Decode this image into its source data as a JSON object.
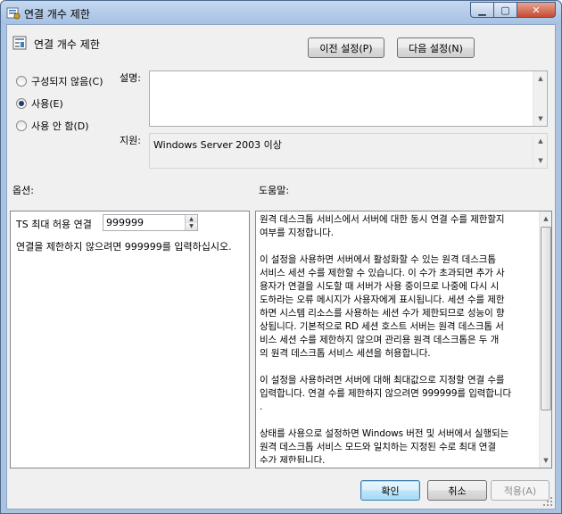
{
  "window": {
    "title": "연결 개수 제한"
  },
  "header": {
    "title": "연결 개수 제한",
    "prev_button": "이전 설정(P)",
    "next_button": "다음 설정(N)"
  },
  "state": {
    "options": [
      {
        "label": "구성되지 않음(C)",
        "checked": false
      },
      {
        "label": "사용(E)",
        "checked": true
      },
      {
        "label": "사용 안 함(D)",
        "checked": false
      }
    ]
  },
  "comment": {
    "label": "설명:",
    "value": ""
  },
  "supported": {
    "label": "지원:",
    "value": "Windows Server 2003 이상"
  },
  "options_section": {
    "label": "옵션:",
    "field_label": "TS 최대 허용 연결",
    "field_value": "999999",
    "note": "연결을 제한하지 않으려면 999999를 입력하십시오."
  },
  "help_section": {
    "label": "도움말:",
    "text": "원격 데스크톱 서비스에서 서버에 대한 동시 연결 수를 제한할지\n여부를 지정합니다.\n\n이 설정을 사용하면 서버에서 활성화할 수 있는 원격 데스크톱\n서비스 세션 수를 제한할 수 있습니다. 이 수가 초과되면 추가 사\n용자가 연결을 시도할 때 서버가 사용 중이므로 나중에 다시 시\n도하라는 오류 메시지가 사용자에게 표시됩니다. 세션 수를 제한\n하면 시스템 리소스를 사용하는 세션 수가 제한되므로 성능이 향\n상됩니다. 기본적으로 RD 세션 호스트 서버는 원격 데스크톱 서\n비스 세션 수를 제한하지 않으며 관리용 원격 데스크톱은 두 개\n의 원격 데스크톱 서비스 세션을 허용합니다.\n\n이 설정을 사용하려면 서버에 대해 최대값으로 지정할 연결 수를\n입력합니다. 연결 수를 제한하지 않으려면 999999를 입력합니다\n.\n\n상태를 사용으로 설정하면 Windows 버전 및 서버에서 실행되는\n원격 데스크톱 서비스 모드와 일치하는 지정된 수로 최대 연결\n수가 제한됩니다.\n\n상태를 사용 안 함 또는 구성되지 않음으로 설정하면 그룹 정책"
  },
  "footer": {
    "ok": "확인",
    "cancel": "취소",
    "apply": "적용(A)"
  },
  "icons": {
    "window": "policy-settings-icon",
    "header": "policy-document-icon"
  }
}
